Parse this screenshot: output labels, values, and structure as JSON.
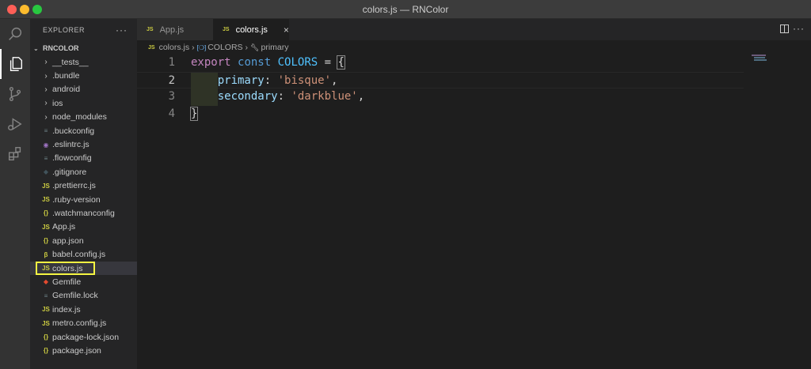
{
  "window": {
    "title": "colors.js — RNColor"
  },
  "activity_bar": [
    {
      "name": "explorer-icon",
      "active": true
    },
    {
      "name": "search-icon",
      "active": false
    },
    {
      "name": "source-control-icon",
      "active": false
    },
    {
      "name": "run-debug-icon",
      "active": false
    },
    {
      "name": "extensions-icon",
      "active": false
    }
  ],
  "sidebar": {
    "header": "EXPLORER",
    "more": "···",
    "root": "RNCOLOR",
    "items": [
      {
        "label": "__tests__",
        "kind": "folder",
        "icon": "›",
        "color": "#cccccc"
      },
      {
        "label": ".bundle",
        "kind": "folder",
        "icon": "›",
        "color": "#cccccc"
      },
      {
        "label": "android",
        "kind": "folder",
        "icon": "›",
        "color": "#cccccc"
      },
      {
        "label": "ios",
        "kind": "folder",
        "icon": "›",
        "color": "#cccccc"
      },
      {
        "label": "node_modules",
        "kind": "folder",
        "icon": "›",
        "color": "#cccccc"
      },
      {
        "label": ".buckconfig",
        "kind": "file",
        "icon": "≡",
        "color": "#6d8086"
      },
      {
        "label": ".eslintrc.js",
        "kind": "file",
        "icon": "◉",
        "color": "#a074c4"
      },
      {
        "label": ".flowconfig",
        "kind": "file",
        "icon": "≡",
        "color": "#6d8086"
      },
      {
        "label": ".gitignore",
        "kind": "file",
        "icon": "◆",
        "color": "#41535b"
      },
      {
        "label": ".prettierrc.js",
        "kind": "file",
        "icon": "JS",
        "color": "#cbcb41"
      },
      {
        "label": ".ruby-version",
        "kind": "file",
        "icon": "JS",
        "color": "#cbcb41"
      },
      {
        "label": ".watchmanconfig",
        "kind": "file",
        "icon": "{}",
        "color": "#cbcb41"
      },
      {
        "label": "App.js",
        "kind": "file",
        "icon": "JS",
        "color": "#cbcb41"
      },
      {
        "label": "app.json",
        "kind": "file",
        "icon": "{}",
        "color": "#cbcb41"
      },
      {
        "label": "babel.config.js",
        "kind": "file",
        "icon": "β",
        "color": "#cbcb41"
      },
      {
        "label": "colors.js",
        "kind": "file",
        "icon": "JS",
        "color": "#cbcb41",
        "selected": true
      },
      {
        "label": "Gemfile",
        "kind": "file",
        "icon": "◆",
        "color": "#e44a2f"
      },
      {
        "label": "Gemfile.lock",
        "kind": "file",
        "icon": "≡",
        "color": "#6d8086"
      },
      {
        "label": "index.js",
        "kind": "file",
        "icon": "JS",
        "color": "#cbcb41"
      },
      {
        "label": "metro.config.js",
        "kind": "file",
        "icon": "JS",
        "color": "#cbcb41"
      },
      {
        "label": "package-lock.json",
        "kind": "file",
        "icon": "{}",
        "color": "#cbcb41"
      },
      {
        "label": "package.json",
        "kind": "file",
        "icon": "{}",
        "color": "#cbcb41"
      }
    ]
  },
  "tabs": [
    {
      "label": "App.js",
      "icon": "JS",
      "active": false
    },
    {
      "label": "colors.js",
      "icon": "JS",
      "active": true,
      "close": "×"
    }
  ],
  "breadcrumbs": {
    "file": "colors.js",
    "symbol1_icon": "[❍]",
    "symbol1": "COLORS",
    "symbol2": "primary",
    "sep": "›"
  },
  "editor": {
    "lines": [
      {
        "num": "1",
        "text": "export const COLORS = {"
      },
      {
        "num": "2",
        "text": "    primary: 'bisque',"
      },
      {
        "num": "3",
        "text": "    secondary: 'darkblue',"
      },
      {
        "num": "4",
        "text": "}"
      }
    ]
  }
}
